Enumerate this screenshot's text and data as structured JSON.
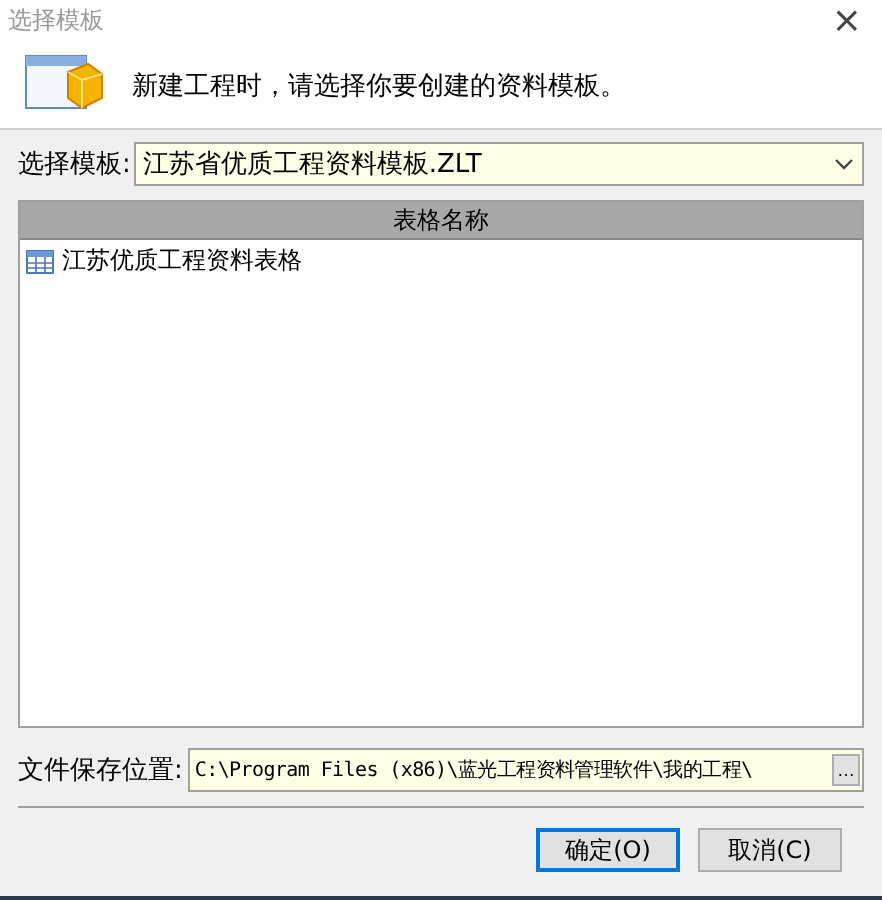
{
  "window": {
    "title": "选择模板",
    "close": "×"
  },
  "header": {
    "message": "新建工程时，请选择你要创建的资料模板。"
  },
  "template": {
    "label": "选择模板:",
    "value": "江苏省优质工程资料模板.ZLT"
  },
  "table": {
    "columns": [
      "表格名称"
    ],
    "rows": [
      {
        "name": "江苏优质工程资料表格",
        "selected": false
      }
    ]
  },
  "save_location": {
    "label": "文件保存位置:",
    "value": "C:\\Program Files (x86)\\蓝光工程资料管理软件\\我的工程\\",
    "browse": "…"
  },
  "buttons": [
    {
      "label": "确定(O)",
      "default": true
    },
    {
      "label": "取消(C)",
      "default": false
    }
  ]
}
